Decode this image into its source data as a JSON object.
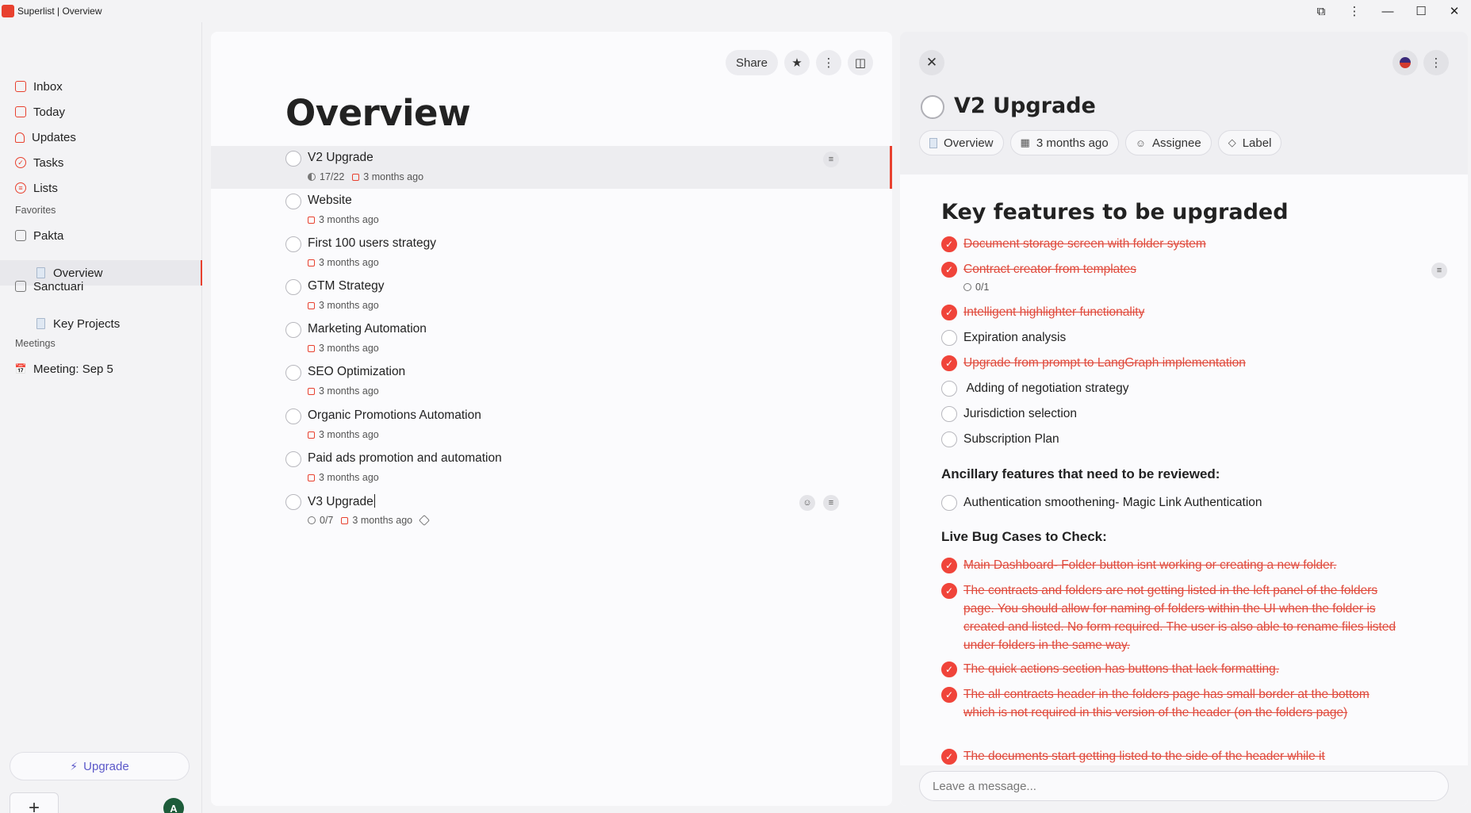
{
  "window": {
    "title": "Superlist | Overview"
  },
  "sidebar": {
    "nav": [
      {
        "label": "Inbox",
        "icon": "inbox-icon"
      },
      {
        "label": "Today",
        "icon": "calendar-icon"
      },
      {
        "label": "Updates",
        "icon": "bell-icon"
      },
      {
        "label": "Tasks",
        "icon": "check-circle-icon"
      },
      {
        "label": "Lists",
        "icon": "list-icon"
      }
    ],
    "favorites_label": "Favorites",
    "groups": [
      {
        "label": "Pakta",
        "children": [
          "Overview"
        ]
      },
      {
        "label": "Sanctuari",
        "children": [
          "Key Projects"
        ]
      }
    ],
    "meetings_label": "Meetings",
    "meetings": [
      "Meeting: Sep 5"
    ],
    "upgrade_label": "Upgrade",
    "add_label": "+",
    "avatar_initial": "A"
  },
  "main": {
    "share_label": "Share",
    "title": "Overview",
    "tasks": [
      {
        "name": "V2 Upgrade",
        "progress": "17/22",
        "date": "3 months ago"
      },
      {
        "name": "Website",
        "date": "3 months ago"
      },
      {
        "name": "First 100 users strategy",
        "date": "3 months ago"
      },
      {
        "name": "GTM Strategy",
        "date": "3 months ago"
      },
      {
        "name": "Marketing Automation",
        "date": "3 months ago"
      },
      {
        "name": "SEO Optimization",
        "date": "3 months ago"
      },
      {
        "name": "Organic Promotions Automation",
        "date": "3 months ago"
      },
      {
        "name": "Paid ads promotion and automation",
        "date": "3 months ago"
      },
      {
        "name": "V3 Upgrade",
        "progress": "0/7",
        "date": "3 months ago"
      }
    ]
  },
  "detail": {
    "title": "V2 Upgrade",
    "chips": {
      "list": "Overview",
      "date": "3 months ago",
      "assignee": "Assignee",
      "label": "Label"
    },
    "heading1": "Key features to be upgraded",
    "key_features": [
      {
        "text": "Document storage screen with folder system",
        "done": true
      },
      {
        "text": "Contract creator from templates",
        "done": true,
        "subcount": "0/1"
      },
      {
        "text": "Intelligent highlighter functionality",
        "done": true
      },
      {
        "text": "Expiration analysis",
        "done": false
      },
      {
        "text": "Upgrade from prompt to LangGraph implementation",
        "done": true
      },
      {
        "text": " Adding of negotiation strategy",
        "done": false
      },
      {
        "text": "Jurisdiction selection",
        "done": false
      },
      {
        "text": "Subscription Plan",
        "done": false
      }
    ],
    "heading2": "Ancillary features that need to be reviewed:",
    "ancillary": [
      {
        "text": "Authentication smoothening- Magic Link Authentication",
        "done": false
      }
    ],
    "heading3": "Live Bug Cases to Check:",
    "bugs": [
      {
        "text": "Main Dashboard- Folder button isnt working or creating a new folder.",
        "done": true
      },
      {
        "text": "The contracts and folders are not getting listed in the left panel of the folders page. You should allow for naming of folders within the UI when the folder is created and listed. No form required. The user is also able to rename files listed under folders in the same way.",
        "done": true
      },
      {
        "text": "The quick actions section has buttons that lack formatting.",
        "done": true
      },
      {
        "text": "The all contracts header in the folders page has small border at the bottom which is not required in this version of the header (on the folders page)",
        "done": true
      },
      {
        "text": "The documents start getting listed to the side of the header while it",
        "done": true
      }
    ],
    "message_placeholder": "Leave a message..."
  },
  "colors": {
    "accent": "#e8412f",
    "upgrade": "#5b58c9"
  }
}
